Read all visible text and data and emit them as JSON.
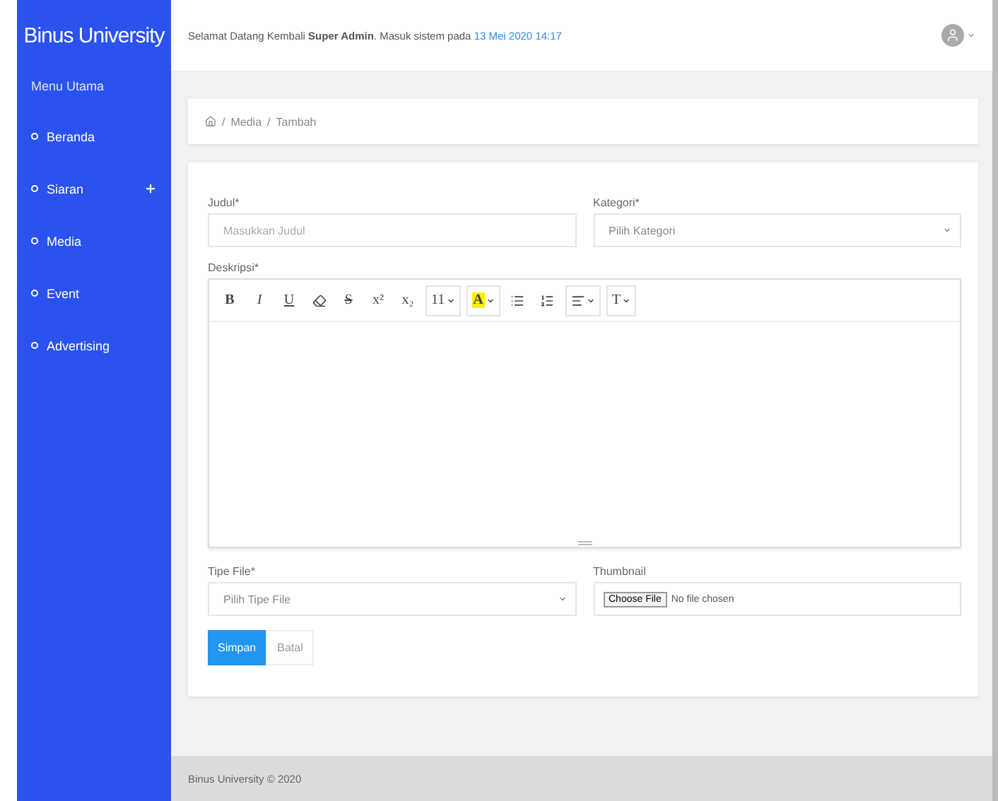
{
  "sidebar": {
    "brand": "Binus University",
    "section": "Menu Utama",
    "items": [
      {
        "label": "Beranda",
        "expandable": false
      },
      {
        "label": "Siaran",
        "expandable": true
      },
      {
        "label": "Media",
        "expandable": false
      },
      {
        "label": "Event",
        "expandable": false
      },
      {
        "label": "Advertising",
        "expandable": false
      }
    ]
  },
  "header": {
    "welcome": "Selamat Datang Kembali **Super Admin**. Masuk sistem pada",
    "timestamp": "13 Mei 2020 14:17"
  },
  "breadcrumb": {
    "separator": "/",
    "items": [
      "Media",
      "Tambah"
    ]
  },
  "form": {
    "title_field": {
      "label": "Judul*",
      "placeholder": "Masukkan Judul"
    },
    "category_field": {
      "label": "Kategori*",
      "value": "Pilih Kategori"
    },
    "description_label": "Deskripsi*",
    "toolbar": [
      {
        "kind": "bold",
        "label": "B"
      },
      {
        "kind": "italic",
        "label": "I"
      },
      {
        "kind": "underline",
        "label": "U"
      },
      {
        "kind": "eraser"
      },
      {
        "kind": "strike",
        "label": "S"
      },
      {
        "kind": "plain",
        "label": "x²"
      },
      {
        "kind": "plain",
        "label": "x₂"
      },
      {
        "kind": "dropdown",
        "label": "11"
      },
      {
        "kind": "highlight",
        "label": "A"
      },
      {
        "kind": "bullets"
      },
      {
        "kind": "numbers"
      },
      {
        "kind": "paragraph"
      },
      {
        "kind": "dropdown",
        "label": "T"
      }
    ],
    "file_type_field": {
      "label": "Tipe File*",
      "value": "Pilih Tipe File"
    },
    "thumbnail_field": {
      "label": "Thumbnail",
      "button": "Choose File",
      "status": "No file chosen"
    },
    "buttons": [
      {
        "label": "Simpan",
        "primary": true
      },
      {
        "label": "Batal",
        "primary": false
      }
    ]
  },
  "footer": "Binus University © 2020"
}
